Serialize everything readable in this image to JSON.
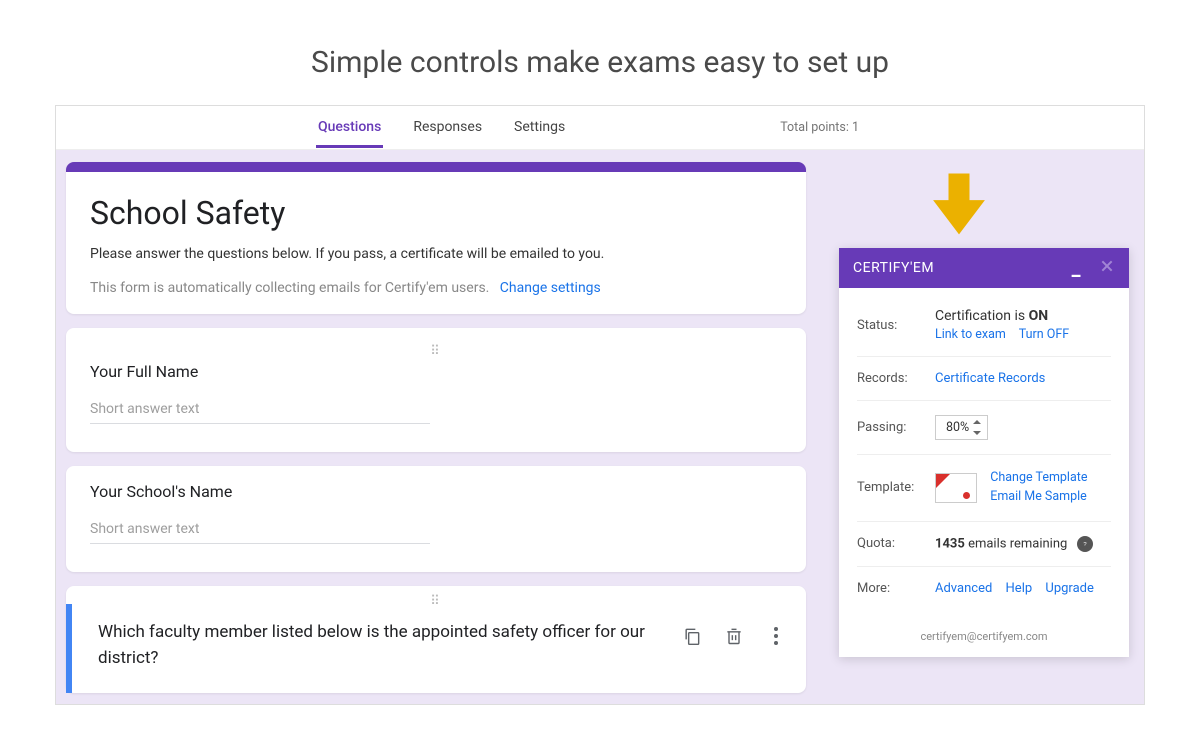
{
  "page_heading": "Simple controls make exams easy to set up",
  "tabs": {
    "questions": "Questions",
    "responses": "Responses",
    "settings": "Settings"
  },
  "total_points": "Total points: 1",
  "form": {
    "title": "School Safety",
    "description": "Please answer the questions below. If you pass, a certificate will be emailed to you.",
    "collecting_notice": "This form is automatically collecting emails for Certify'em users.",
    "change_settings": "Change settings",
    "short_answer_placeholder": "Short answer text",
    "q1_label": "Your Full Name",
    "q2_label": "Your School's Name",
    "q3_text": "Which faculty member listed below is the appointed safety officer for our district?"
  },
  "sidepanel": {
    "title": "CERTIFY'EM",
    "status_label": "Status:",
    "status_text_prefix": "Certification is ",
    "status_text_bold": "ON",
    "link_to_exam": "Link to exam",
    "turn_off": "Turn OFF",
    "records_label": "Records:",
    "records_link": "Certificate Records",
    "passing_label": "Passing:",
    "passing_value": "80%",
    "template_label": "Template:",
    "change_template": "Change Template",
    "email_sample": "Email Me Sample",
    "quota_label": "Quota:",
    "quota_bold": "1435",
    "quota_rest": " emails remaining",
    "more_label": "More:",
    "more_advanced": "Advanced",
    "more_help": "Help",
    "more_upgrade": "Upgrade",
    "footer_email": "certifyem@certifyem.com"
  }
}
